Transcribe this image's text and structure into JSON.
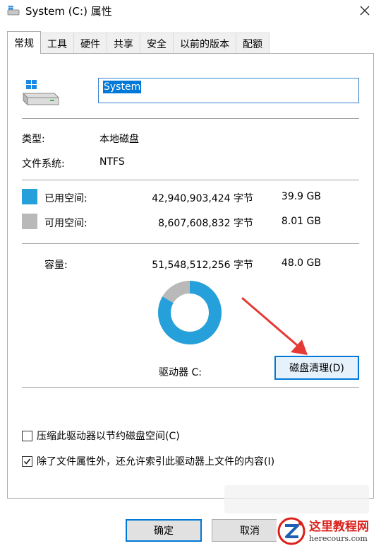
{
  "window": {
    "title": "System (C:) 属性"
  },
  "tabs": [
    {
      "label": "常规",
      "active": true
    },
    {
      "label": "工具"
    },
    {
      "label": "硬件"
    },
    {
      "label": "共享"
    },
    {
      "label": "安全"
    },
    {
      "label": "以前的版本"
    },
    {
      "label": "配额"
    }
  ],
  "general": {
    "drive_name": "System",
    "type_label": "类型:",
    "type_value": "本地磁盘",
    "fs_label": "文件系统:",
    "fs_value": "NTFS",
    "used": {
      "label": "已用空间:",
      "bytes": "42,940,903,424 字节",
      "size": "39.9 GB",
      "color": "#26a0da"
    },
    "free": {
      "label": "可用空间:",
      "bytes": "8,607,608,832 字节",
      "size": "8.01 GB",
      "color": "#b9b9b9"
    },
    "capacity": {
      "label": "容量:",
      "bytes": "51,548,512,256 字节",
      "size": "48.0 GB"
    },
    "drive_label": "驱动器 C:",
    "cleanup_button": "磁盘清理(D)",
    "used_fraction": 0.833,
    "compress_label": "压缩此驱动器以节约磁盘空间(C)",
    "compress_checked": false,
    "index_label": "除了文件属性外，还允许索引此驱动器上文件的内容(I)",
    "index_checked": true
  },
  "footer": {
    "ok": "确定",
    "cancel": "取消"
  },
  "watermark": {
    "cn": "这里教程网",
    "en": "herecours.com"
  },
  "icons": {
    "title": "drive-icon",
    "close": "close-icon",
    "arrow": "red-arrow"
  }
}
